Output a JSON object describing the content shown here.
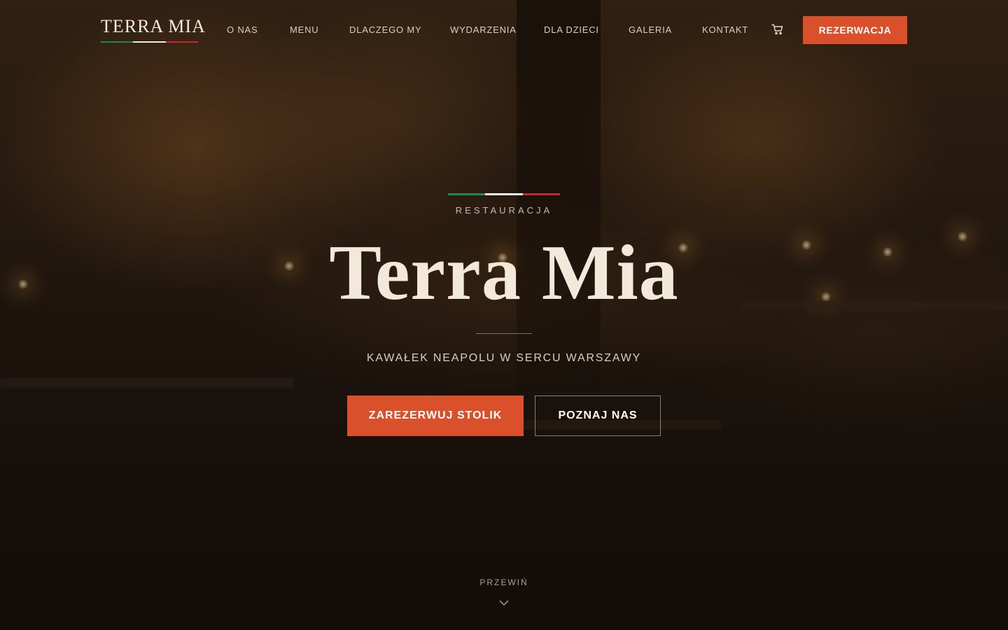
{
  "header": {
    "logo": "TERRA MIA",
    "nav": [
      {
        "label": "O NAS"
      },
      {
        "label": "MENU"
      },
      {
        "label": "DLACZEGO MY"
      },
      {
        "label": "WYDARZENIA"
      },
      {
        "label": "DLA DZIECI"
      },
      {
        "label": "GALERIA"
      },
      {
        "label": "KONTAKT"
      }
    ],
    "cart_icon": "cart-icon",
    "cta_label": "REZERWACJA"
  },
  "hero": {
    "eyebrow": "RESTAURACJA",
    "title": "Terra Mia",
    "subtitle": "KAWAŁEK NEAPOLU W SERCU WARSZAWY",
    "primary_button": "ZAREZERWUJ STOLIK",
    "secondary_button": "POZNAJ NAS",
    "scroll_hint": "PRZEWIŃ",
    "scroll_icon": "chevron-down-icon"
  },
  "colors": {
    "accent": "#d9502a",
    "flag_green": "#1f8a4c",
    "flag_white": "#f2ede4",
    "flag_red": "#c8252c",
    "text_cream": "#f2e9da"
  }
}
